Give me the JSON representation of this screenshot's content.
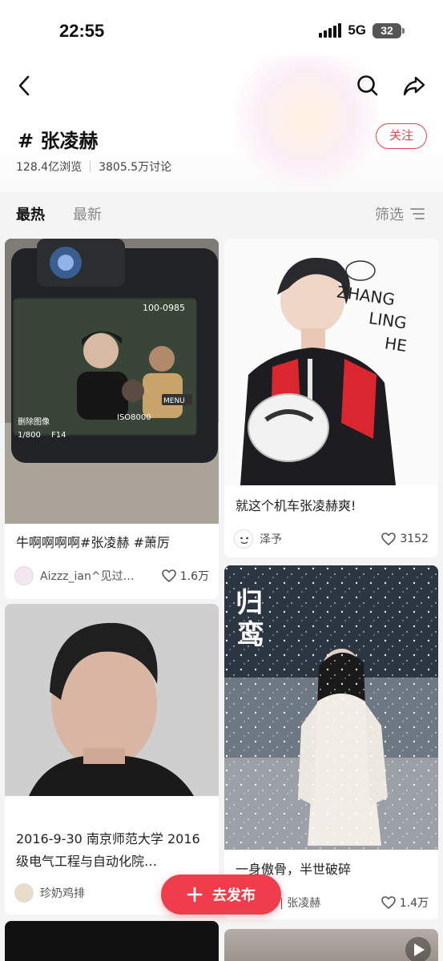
{
  "status_bar": {
    "time": "22:55",
    "network": "5G",
    "battery": "32"
  },
  "header": {
    "topic_title": "# 张凌赫",
    "views": "128.4亿浏览",
    "discussions": "3805.5万讨论",
    "follow_label": "关注"
  },
  "tabs": {
    "hot": "最热",
    "latest": "最新",
    "filter": "筛选"
  },
  "posts": [
    {
      "title": "牛啊啊啊啊#张凌赫 #萧厉",
      "author": "Aizzz_ian^见过…",
      "likes": "1.6万"
    },
    {
      "title": "就这个机车张凌赫爽!",
      "author": "泽予",
      "likes": "3152"
    },
    {
      "title": "2016-9-30 南京师范大学 2016级电气工程与自动化院…",
      "author": "珍奶鸡排",
      "likes": ""
    },
    {
      "title": "一身傲骨，半世破碎",
      "author": "AMORU | 张凌赫",
      "likes": "1.4万"
    }
  ],
  "image_text": {
    "camera_counter": "100-0985",
    "camera_shutter": "1/800",
    "camera_aperture": "F14",
    "camera_iso": "ISO8000",
    "camera_menu": "MENU",
    "camera_delete": "删除图像",
    "illustration_text_1": "ZHANG",
    "illustration_text_2": "LING",
    "illustration_text_3": "HE",
    "poster_title_1": "归",
    "poster_title_2": "鸾"
  },
  "publish_button": {
    "label": "去发布"
  },
  "colors": {
    "accent": "#ef3d4c",
    "follow": "#e8444e"
  }
}
